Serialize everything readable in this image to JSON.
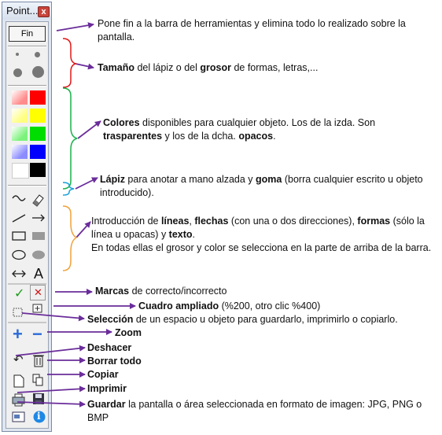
{
  "window": {
    "title": "Point...",
    "close_glyph": "x",
    "fin_label": "Fin"
  },
  "swatches": [
    {
      "name": "red-transparent",
      "color": "#ff8c8c"
    },
    {
      "name": "red-opaque",
      "color": "#ff0000"
    },
    {
      "name": "yellow-transparent",
      "color": "#ffff80"
    },
    {
      "name": "yellow-opaque",
      "color": "#ffff00"
    },
    {
      "name": "green-transparent",
      "color": "#7cf27c"
    },
    {
      "name": "green-opaque",
      "color": "#00dd00"
    },
    {
      "name": "blue-transparent",
      "color": "#8c8cff"
    },
    {
      "name": "blue-opaque",
      "color": "#0000ff"
    },
    {
      "name": "white",
      "color": "#ffffff"
    },
    {
      "name": "black",
      "color": "#000000"
    }
  ],
  "tool_glyphs": {
    "text_tool": "A",
    "check": "✓",
    "cross": "✕",
    "zoom_in": "+",
    "zoom_out": "−",
    "undo": "↶",
    "info": "i"
  },
  "annotations": {
    "fin": {
      "text": "Pone fin a la barra de herramientas y elimina todo lo realizado sobre la pantalla."
    },
    "tamano": {
      "b1": "Tamaño",
      "t1": " del lápiz o del ",
      "b2": "grosor",
      "t2": " de formas, letras,..."
    },
    "colores": {
      "b1": "Colores",
      "t1": " disponibles para cualquier objeto. Los de la izda. Son ",
      "b2": "trasparentes",
      "t2": " y los de la dcha. ",
      "b3": "opacos",
      "t3": "."
    },
    "lapiz": {
      "b1": "Lápiz",
      "t1": " para anotar a mano alzada y ",
      "b2": "goma",
      "t2": " (borra cualquier escrito u objeto introducido)."
    },
    "lineas": {
      "t0": "Introducción de ",
      "b1": "líneas",
      "t1": ", ",
      "b2": "flechas",
      "t2": " (con una o dos direcciones), ",
      "b3": "formas",
      "t3": " (sólo la línea u opacas) y ",
      "b4": "texto",
      "t4": ".",
      "line2": "En todas ellas el grosor y color se selecciona en la parte de arriba de la barra."
    },
    "marcas": {
      "b1": "Marcas",
      "t1": " de correcto/incorrecto"
    },
    "cuadro": {
      "b1": "Cuadro ampliado",
      "t1": " (%200, otro clic %400)"
    },
    "seleccion": {
      "b1": "Selección",
      "t1": " de un espacio u objeto para guardarlo, imprimirlo o copiarlo."
    },
    "zoom": {
      "b1": "Zoom"
    },
    "deshacer": {
      "b1": "Deshacer"
    },
    "borrar": {
      "b1": "Borrar todo"
    },
    "copiar": {
      "b1": "Copiar"
    },
    "imprimir": {
      "b1": "Imprimir"
    },
    "guardar": {
      "b1": "Guardar",
      "t1": " la pantalla o área seleccionada en formato de imagen: JPG, PNG o BMP"
    }
  },
  "colors": {
    "arrow": "#6a2d9a",
    "brace_red": "#e01818",
    "brace_green": "#19b24a",
    "brace_blue": "#1aa0d8",
    "brace_orange": "#f0a23a"
  }
}
